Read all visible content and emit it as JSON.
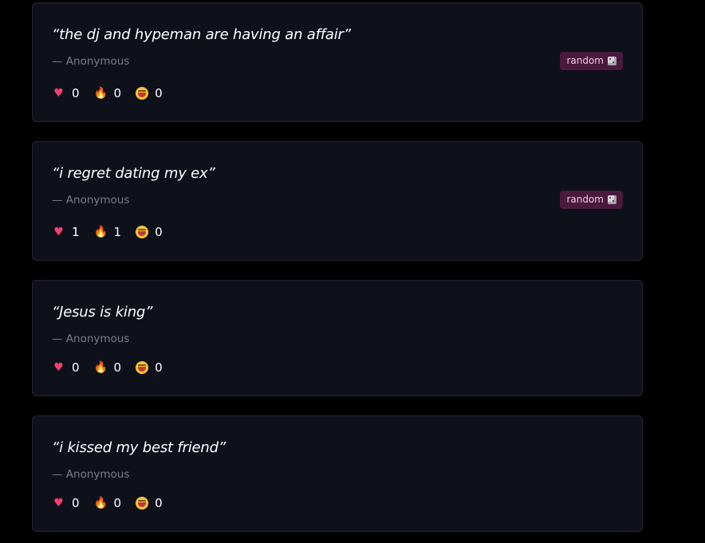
{
  "posts": [
    {
      "quote": "“the dj and hypeman are having an affair”",
      "author": "— Anonymous",
      "tag": "random",
      "reactions": {
        "heart": "0",
        "fire": "0",
        "laugh": "0"
      }
    },
    {
      "quote": "“i regret dating my ex”",
      "author": "— Anonymous",
      "tag": "random",
      "reactions": {
        "heart": "1",
        "fire": "1",
        "laugh": "0"
      }
    },
    {
      "quote": "“Jesus is king”",
      "author": "— Anonymous",
      "tag": "",
      "reactions": {
        "heart": "0",
        "fire": "0",
        "laugh": "0"
      }
    },
    {
      "quote": "“i kissed my best friend”",
      "author": "— Anonymous",
      "tag": "",
      "reactions": {
        "heart": "0",
        "fire": "0",
        "laugh": "0"
      }
    }
  ],
  "icons": {
    "heart": "heart-icon",
    "fire": "fire-icon",
    "laugh": "laughing-face-icon",
    "tag": "dice-icon"
  },
  "colors": {
    "background": "#000000",
    "card": "#0e111a",
    "card_border": "#2b2233",
    "tag_background": "#4a1a3c",
    "tag_text": "#f1c6e2",
    "author_text": "#7a7d88"
  }
}
